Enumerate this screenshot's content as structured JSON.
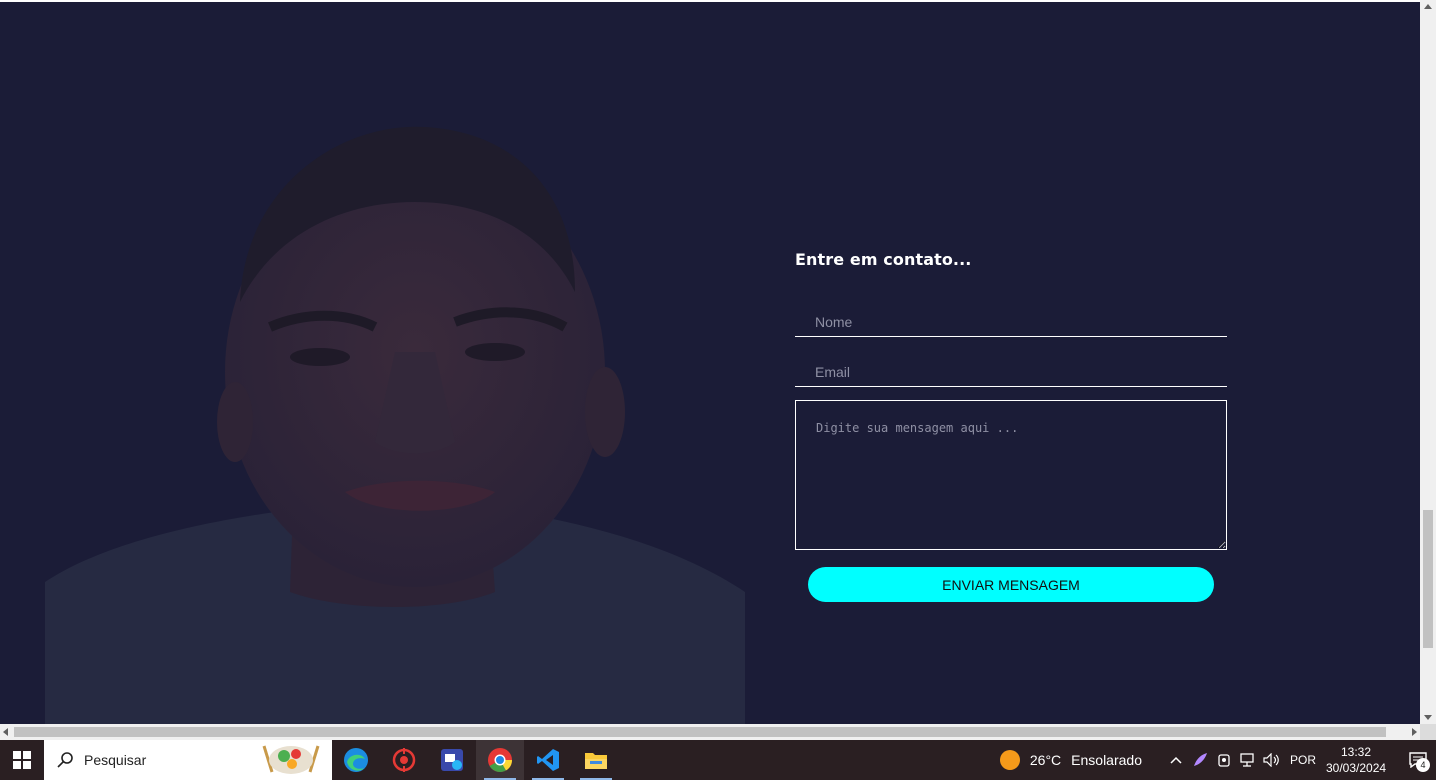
{
  "contact": {
    "title": "Entre em contato...",
    "name_placeholder": "Nome",
    "email_placeholder": "Email",
    "message_placeholder": "Digite sua mensagem aqui ...",
    "submit_label": "ENVIAR MENSAGEM"
  },
  "colors": {
    "background": "#1b1c37",
    "accent": "#00ffff",
    "text": "#ffffff"
  },
  "taskbar": {
    "search_label": "Pesquisar",
    "apps": [
      "edge-icon",
      "tool-icon",
      "remote-icon",
      "chrome-icon",
      "vscode-icon",
      "file-explorer-icon"
    ],
    "weather_temp": "26°C",
    "weather_desc": "Ensolarado",
    "language": "POR",
    "time": "13:32",
    "date": "30/03/2024",
    "notification_count": "4"
  }
}
